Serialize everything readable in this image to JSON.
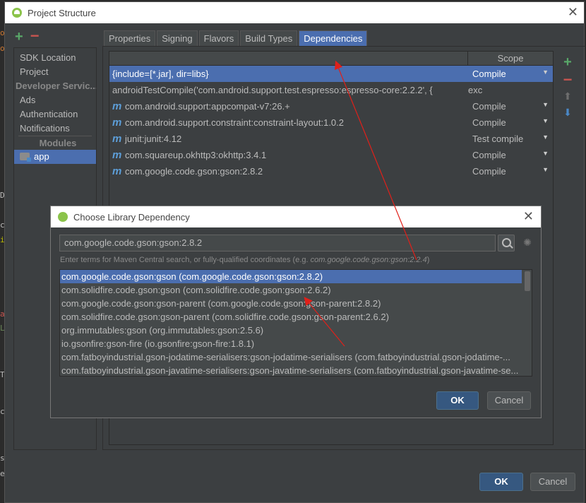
{
  "window": {
    "title": "Project Structure",
    "close_glyph": "✕"
  },
  "left_panel": {
    "items": [
      {
        "label": "SDK Location"
      },
      {
        "label": "Project"
      }
    ],
    "developer_services_header": "Developer Servic...",
    "developer_services": [
      {
        "label": "Ads"
      },
      {
        "label": "Authentication"
      },
      {
        "label": "Notifications"
      }
    ],
    "modules_header": "Modules",
    "modules": [
      {
        "label": "app"
      }
    ]
  },
  "tabs": [
    {
      "label": "Properties"
    },
    {
      "label": "Signing"
    },
    {
      "label": "Flavors"
    },
    {
      "label": "Build Types"
    },
    {
      "label": "Dependencies"
    }
  ],
  "dependencies": {
    "scope_header": "Scope",
    "rows": [
      {
        "name": "{include=[*.jar], dir=libs}",
        "scope": "Compile",
        "icon": "none"
      },
      {
        "name": "androidTestCompile('com.android.support.test.espresso:espresso-core:2.2.2', {",
        "scope": "exc",
        "icon": "none"
      },
      {
        "name": "com.android.support:appcompat-v7:26.+",
        "scope": "Compile",
        "icon": "maven-icon"
      },
      {
        "name": "com.android.support.constraint:constraint-layout:1.0.2",
        "scope": "Compile",
        "icon": "maven-icon"
      },
      {
        "name": "junit:junit:4.12",
        "scope": "Test compile",
        "icon": "maven-icon"
      },
      {
        "name": "com.squareup.okhttp3:okhttp:3.4.1",
        "scope": "Compile",
        "icon": "maven-icon"
      },
      {
        "name": "com.google.code.gson:gson:2.8.2",
        "scope": "Compile",
        "icon": "maven-icon"
      }
    ]
  },
  "main_buttons": {
    "ok": "OK",
    "cancel": "Cancel"
  },
  "dialog": {
    "title": "Choose Library Dependency",
    "close_glyph": "✕",
    "search_value": "com.google.code.gson:gson:2.8.2",
    "hint_prefix": "Enter terms for Maven Central search, or fully-qualified coordinates (e.g. ",
    "hint_example": "com.google.code.gson:gson:2.2.4",
    "hint_suffix": ")",
    "results": [
      "com.google.code.gson:gson (com.google.code.gson:gson:2.8.2)",
      "com.solidfire.code.gson:gson (com.solidfire.code.gson:gson:2.6.2)",
      "com.google.code.gson:gson-parent (com.google.code.gson:gson-parent:2.8.2)",
      "com.solidfire.code.gson:gson-parent (com.solidfire.code.gson:gson-parent:2.6.2)",
      "org.immutables:gson (org.immutables:gson:2.5.6)",
      "io.gsonfire:gson-fire (io.gsonfire:gson-fire:1.8.1)",
      "com.fatboyindustrial.gson-jodatime-serialisers:gson-jodatime-serialisers (com.fatboyindustrial.gson-jodatime-...",
      "com.fatboyindustrial.gson-javatime-serialisers:gson-javatime-serialisers (com.fatboyindustrial.gson-javatime-se..."
    ],
    "ok": "OK",
    "cancel": "Cancel"
  },
  "colors": {
    "selection": "#4b6eaf",
    "panel": "#3c3f41",
    "arrow": "#e0201a"
  }
}
